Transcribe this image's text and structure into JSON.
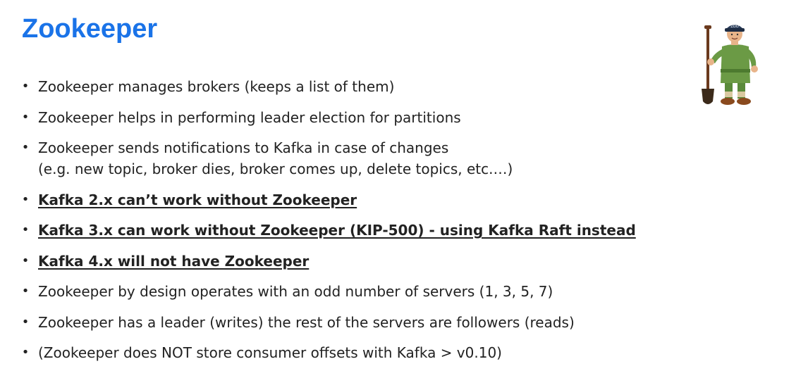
{
  "slide": {
    "title": "Zookeeper",
    "title_color": "#1a73e8",
    "text_color": "#222222",
    "illustration_icon": "zookeeper-with-shovel-icon",
    "cap_text": "ZOO",
    "bullets": [
      {
        "lines": [
          "Zookeeper manages brokers (keeps a list of them)"
        ],
        "emphasis": false
      },
      {
        "lines": [
          "Zookeeper helps in performing leader election for partitions"
        ],
        "emphasis": false
      },
      {
        "lines": [
          "Zookeeper sends notifications to Kafka in case of changes",
          "(e.g. new topic, broker dies, broker comes up, delete topics, etc.…)"
        ],
        "emphasis": false
      },
      {
        "lines": [
          "Kafka 2.x can’t work without Zookeeper"
        ],
        "emphasis": true
      },
      {
        "lines": [
          "Kafka 3.x can work without Zookeeper (KIP-500) - using Kafka Raft instead"
        ],
        "emphasis": true
      },
      {
        "lines": [
          "Kafka 4.x will not have Zookeeper"
        ],
        "emphasis": true
      },
      {
        "lines": [
          "Zookeeper by design operates with an odd number of servers (1, 3, 5, 7)"
        ],
        "emphasis": false
      },
      {
        "lines": [
          "Zookeeper has a leader (writes) the rest of the servers are followers (reads)"
        ],
        "emphasis": false
      },
      {
        "lines": [
          "(Zookeeper does NOT store consumer offsets with Kafka > v0.10)"
        ],
        "emphasis": false
      }
    ],
    "bullet_glyph": "•"
  }
}
